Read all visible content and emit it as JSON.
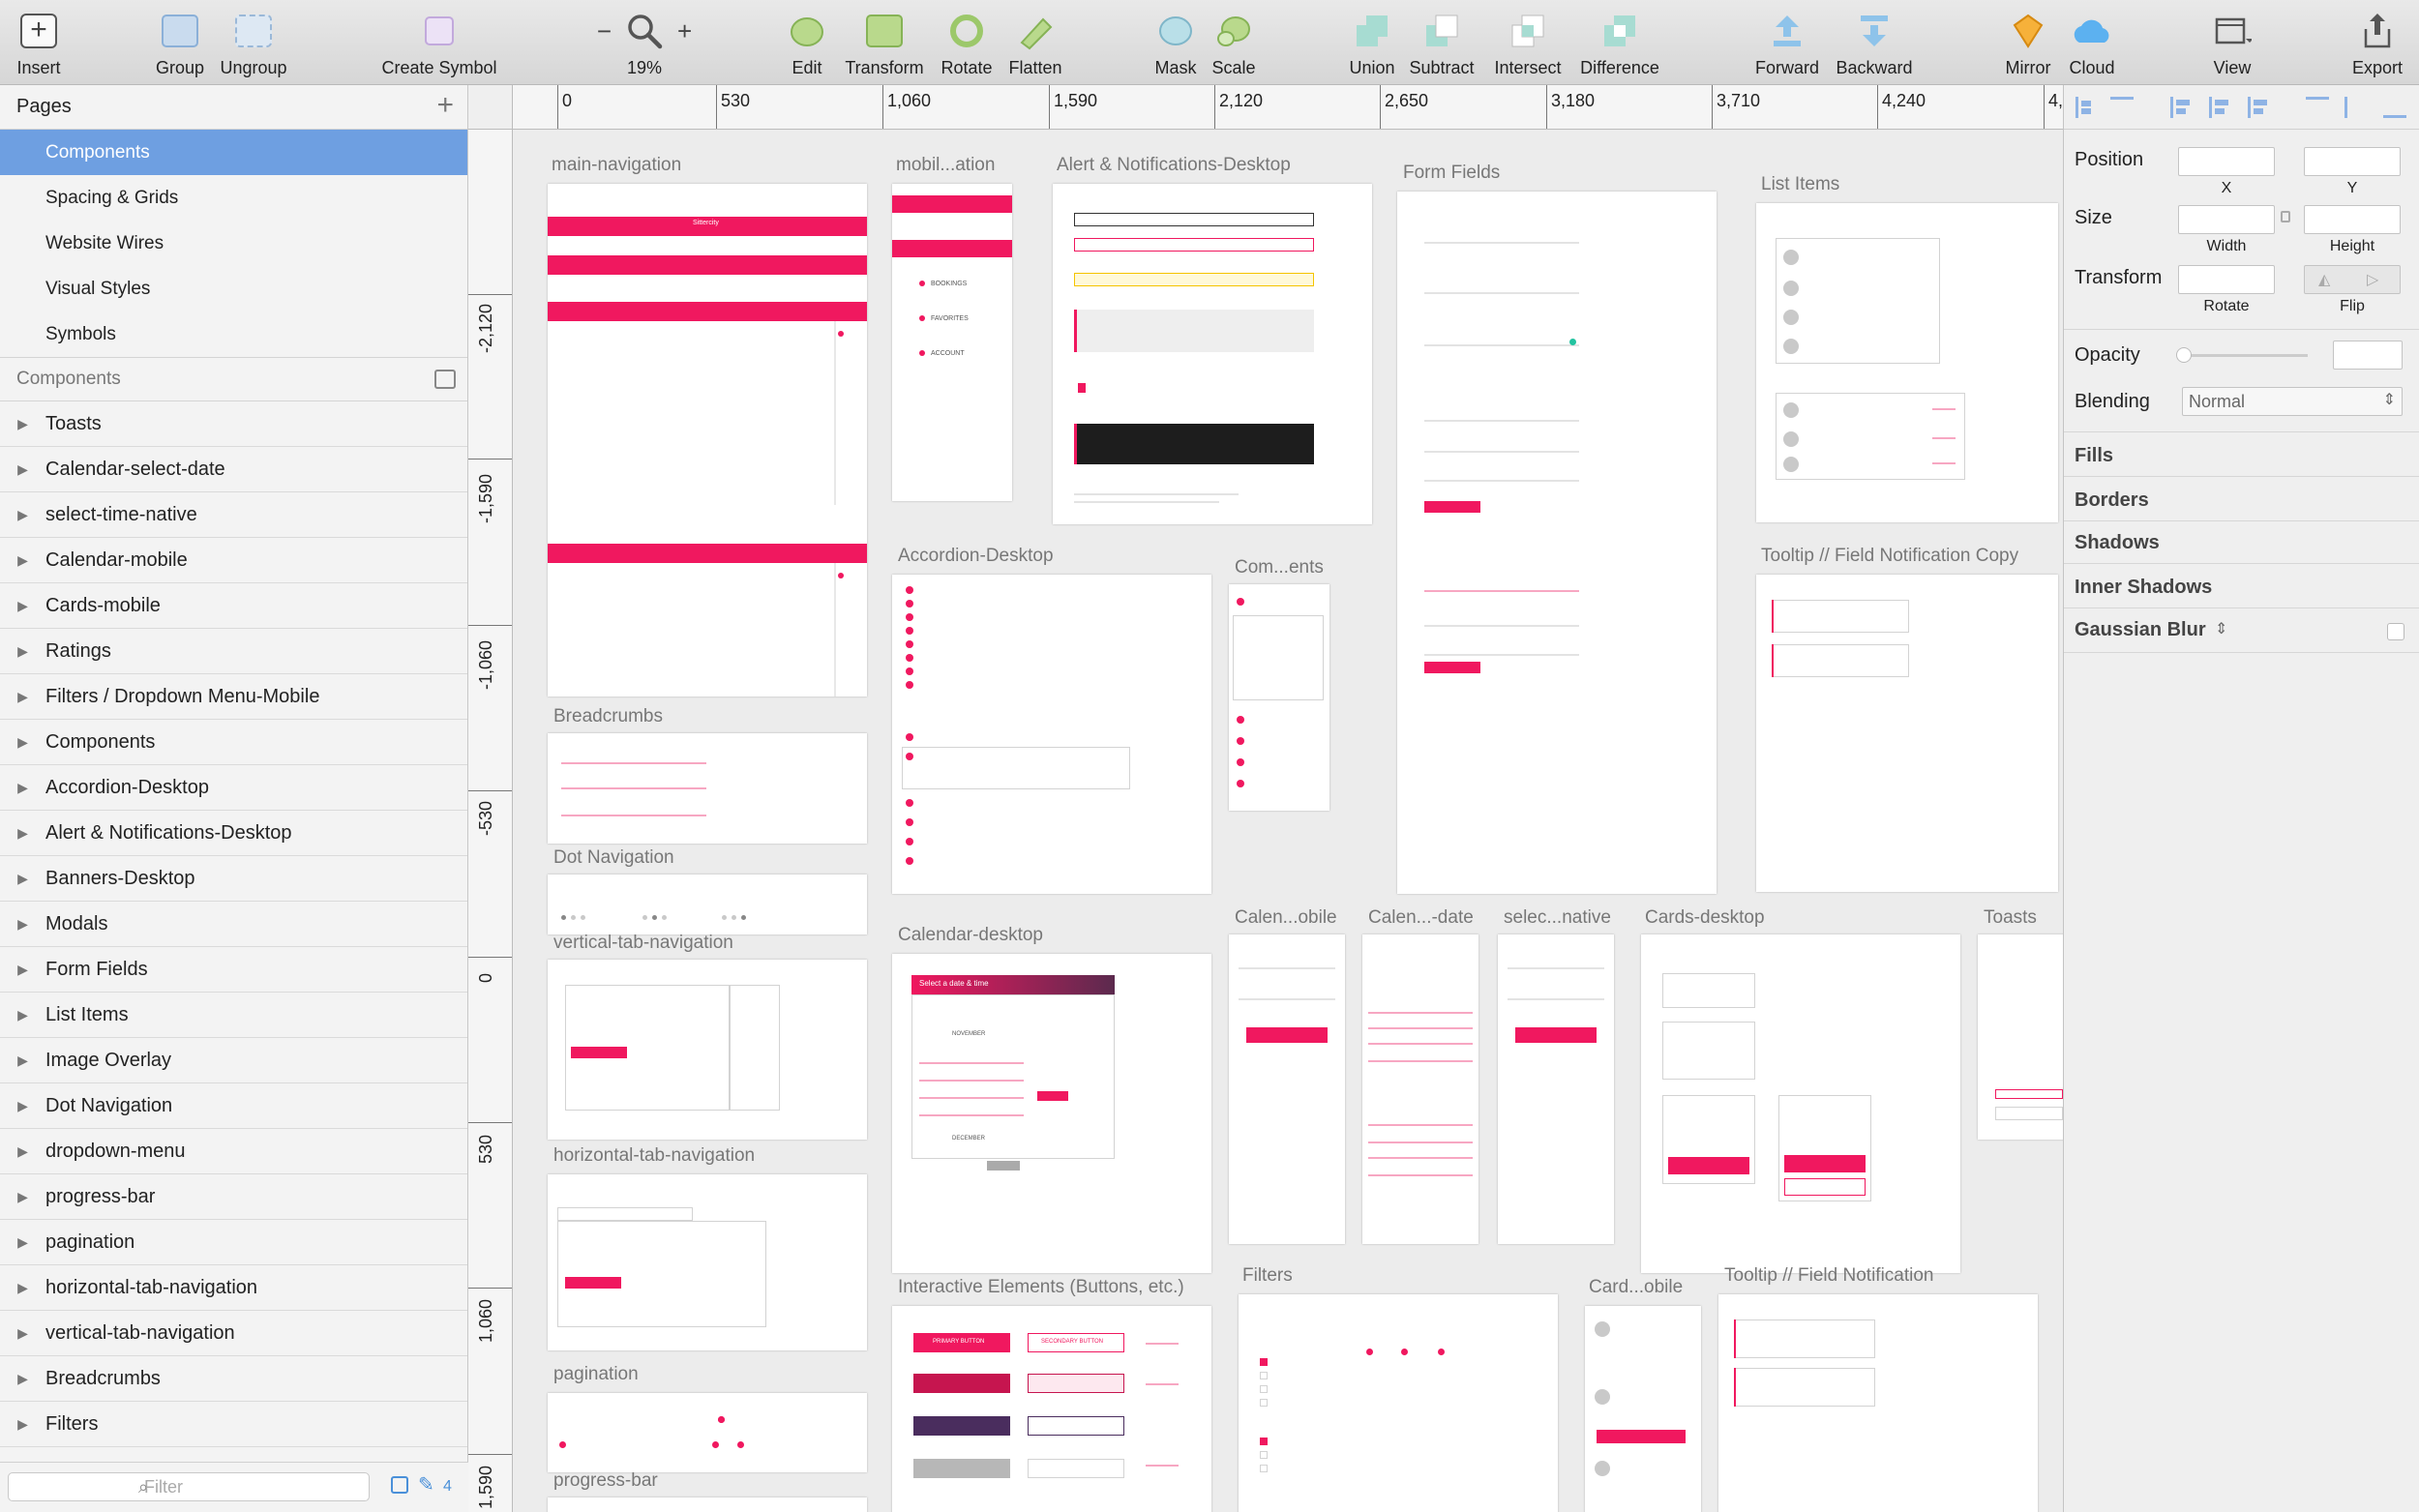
{
  "toolbar": {
    "insert": "Insert",
    "group": "Group",
    "ungroup": "Ungroup",
    "create_symbol": "Create Symbol",
    "zoom_minus": "−",
    "zoom_plus": "+",
    "zoom": "19%",
    "edit": "Edit",
    "transform": "Transform",
    "rotate": "Rotate",
    "flatten": "Flatten",
    "mask": "Mask",
    "scale": "Scale",
    "union": "Union",
    "subtract": "Subtract",
    "intersect": "Intersect",
    "difference": "Difference",
    "forward": "Forward",
    "backward": "Backward",
    "mirror": "Mirror",
    "cloud": "Cloud",
    "view": "View",
    "export": "Export"
  },
  "pages": {
    "title": "Pages",
    "items": [
      "Components",
      "Spacing & Grids",
      "Website Wires",
      "Visual Styles",
      "Symbols"
    ],
    "selected": "Components"
  },
  "layers": {
    "title": "Components",
    "items": [
      "Toasts",
      "Calendar-select-date",
      "select-time-native",
      "Calendar-mobile",
      "Cards-mobile",
      "Ratings",
      "Filters / Dropdown Menu-Mobile",
      "Components",
      "Accordion-Desktop",
      "Alert & Notifications-Desktop",
      "Banners-Desktop",
      "Modals",
      "Form Fields",
      "List Items",
      "Image Overlay",
      "Dot Navigation",
      "dropdown-menu",
      "progress-bar",
      "pagination",
      "horizontal-tab-navigation",
      "vertical-tab-navigation",
      "Breadcrumbs",
      "Filters"
    ],
    "filter_placeholder": "Filter",
    "count": "4"
  },
  "ruler": {
    "h": [
      "0",
      "530",
      "1,060",
      "1,590",
      "2,120",
      "2,650",
      "3,180",
      "3,710",
      "4,240",
      "4,"
    ],
    "v": [
      "-2,120",
      "-1,590",
      "-1,060",
      "-530",
      "0",
      "530",
      "1,060",
      "1,590"
    ]
  },
  "artboards": {
    "main_navigation": "main-navigation",
    "mobile_navigation": "mobil...ation",
    "alerts": "Alert & Notifications-Desktop",
    "form_fields": "Form Fields",
    "list_items": "List Items",
    "breadcrumbs": "Breadcrumbs",
    "dot_navigation": "Dot Navigation",
    "vertical_tab": "vertical-tab-navigation",
    "horizontal_tab": "horizontal-tab-navigation",
    "pagination": "pagination",
    "progress_bar": "progress-bar",
    "accordion": "Accordion-Desktop",
    "components": "Com...ents",
    "tooltip_copy": "Tooltip // Field Notification Copy",
    "calendar_desktop": "Calendar-desktop",
    "calendar_mobile": "Calen...obile",
    "calendar_date": "Calen...-date",
    "select_native": "selec...native",
    "cards_desktop": "Cards-desktop",
    "toasts": "Toasts",
    "interactive": "Interactive Elements (Buttons, etc.)",
    "filters": "Filters",
    "cards_mobile": "Card...obile",
    "tooltip": "Tooltip // Field Notification"
  },
  "mini_text": {
    "sittercity": "Sittercity",
    "bookings": "BOOKINGS",
    "favorites": "FAVORITES",
    "account": "ACCOUNT",
    "select_date_time": "Select a date & time",
    "november": "NOVEMBER",
    "december": "DECEMBER",
    "primary_button": "PRIMARY BUTTON",
    "secondary_button": "SECONDARY BUTTON"
  },
  "inspector": {
    "position": "Position",
    "x": "X",
    "y": "Y",
    "size": "Size",
    "width": "Width",
    "height": "Height",
    "transform": "Transform",
    "rotate": "Rotate",
    "flip": "Flip",
    "opacity": "Opacity",
    "blending": "Blending",
    "blending_value": "Normal",
    "fills": "Fills",
    "borders": "Borders",
    "shadows": "Shadows",
    "inner_shadows": "Inner Shadows",
    "gaussian_blur": "Gaussian Blur"
  },
  "colors": {
    "accent": "#f0185f",
    "selection": "#6e9fe1",
    "dark_header": "#5b2a4e"
  }
}
